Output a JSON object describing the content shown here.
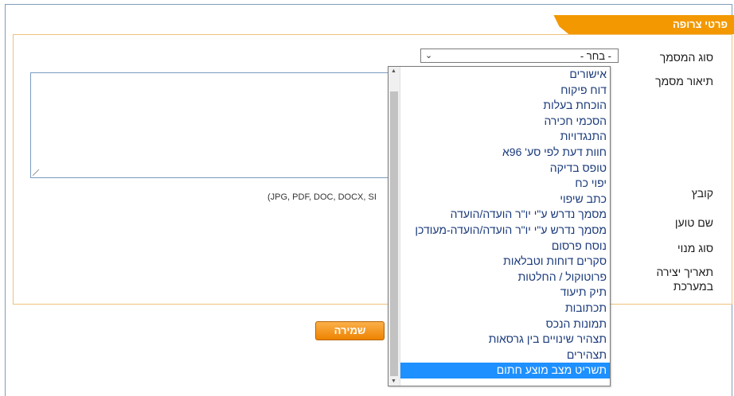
{
  "section": {
    "title": "פרטי צרופה"
  },
  "form": {
    "labels": {
      "doc_type": "סוג המסמך",
      "doc_description": "תיאור מסמך",
      "file": "קובץ",
      "uploader_name": "שם טוען",
      "appointment_type": "סוג מנוי",
      "creation_date_line1": "תאריך יצירה",
      "creation_date_line2": "במערכת"
    },
    "doc_type_value": "- בחר -",
    "file_hint": "(JPG, PDF, DOC, DOCX, SI",
    "save_label": "שמירה"
  },
  "dropdown": {
    "options": [
      "אישורים",
      "דוח פיקוח",
      "הוכחת בעלות",
      "הסכמי חכירה",
      "התנגדויות",
      "חוות דעת לפי סע' 96א",
      "טופס בדיקה",
      "יפוי כח",
      "כתב שיפוי",
      "מסמך נדרש ע\"י יו\"ר הועדה/הועדה",
      "מסמך נדרש ע\"י יו\"ר הועדה/הועדה-מעודכן",
      "נוסח פרסום",
      "סקרים דוחות וטבלאות",
      "פרוטוקול / החלטות",
      "תיק תיעוד",
      "תכתובות",
      "תמונות הנכס",
      "תצהיר שינויים בין גרסאות",
      "תצהירים",
      "תשריט מצב מוצע חתום"
    ],
    "selected_index": 19
  },
  "colors": {
    "accent": "#f39800",
    "selected": "#1e90ff",
    "option_text": "#1a3a7a"
  }
}
